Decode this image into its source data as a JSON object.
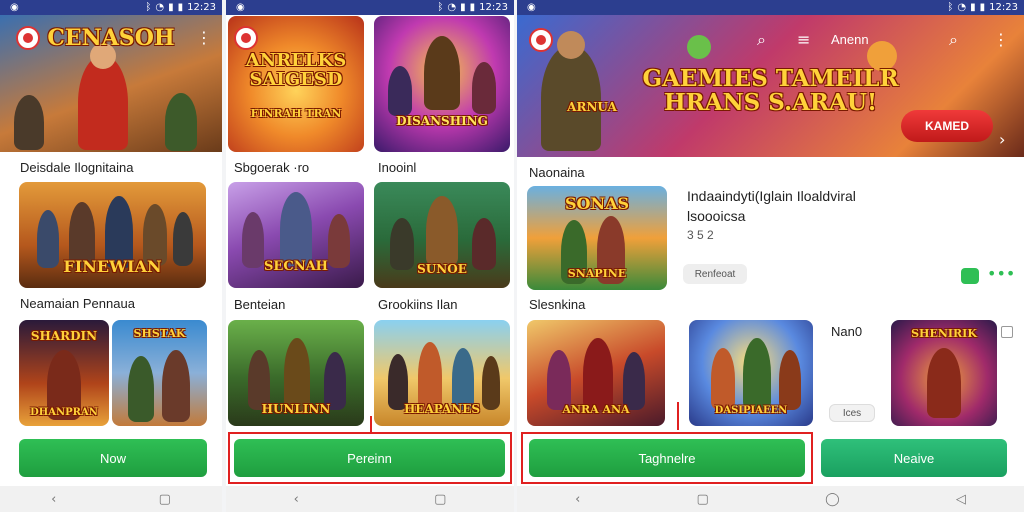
{
  "colors": {
    "statusbar": "#2c3e8f",
    "accent_green": "#22a845",
    "highlight_red": "#e02020"
  },
  "status": {
    "time": "12:23",
    "time_center": "12:23",
    "time_right": "12:23"
  },
  "screen1": {
    "banner_title": "CENASOH",
    "section1": "Deisdale Ilognitaina",
    "card1_title": "FINEWIAN",
    "section2": "Neamaian Pennaua",
    "card2_title": "SHARDIN",
    "card2b_title": "SHSTAK",
    "card2_sub": "DHANPRAN",
    "button": "Now"
  },
  "screen2": {
    "card1_title": "ANRELKS SAIGESD",
    "card1_sub": "FINRAH TRAN",
    "card2_title": "DISANSHING",
    "label1": "Sbgoerak ·ro",
    "label2": "Inooinl",
    "card3_title": "SECNAH",
    "card4_title": "SUNOE",
    "label3": "Benteian",
    "label4": "Grookiins Ilan",
    "card5_title": "HUNLINN",
    "card6_title": "HEAPANES",
    "button": "Pereinn"
  },
  "screen3": {
    "banner_title": "GAEMIES TAMEILR HRANS S.ARAU!",
    "banner_sub": "ARNUA",
    "banner_button": "KAMED",
    "header_text": "Anenn",
    "section1": "Naonaina",
    "card1_title": "SONAS",
    "card1_sub": "SNAPINE",
    "app_name_line1": "Indaaindyti(Iglain Iloaldviral",
    "app_name_line2": "lsoooicsa",
    "app_rating": "3 5 2",
    "tag_pill": "Renfeoat",
    "section2": "Slesnkina",
    "card2_title": "ANRA ANA",
    "card3_title": "DASIPIAEEN",
    "side_label": "Nan0",
    "card4_title": "SHENIRIK",
    "dropdown": "Ices",
    "button1": "Taghnelre",
    "button2": "Neaive"
  }
}
